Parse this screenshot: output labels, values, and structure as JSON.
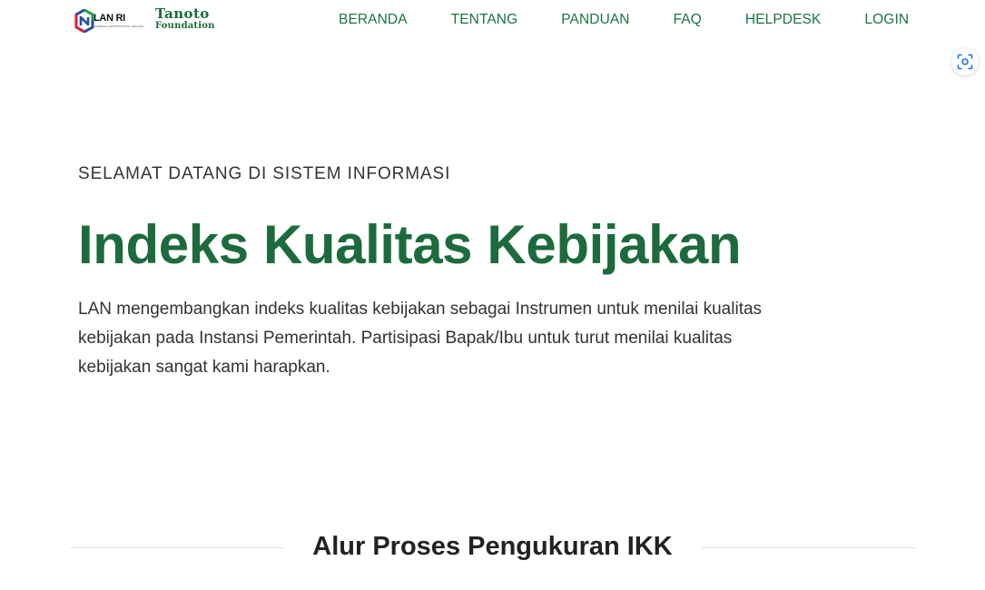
{
  "header": {
    "logo_lan": {
      "text": "LAN RI",
      "subtext": "LEMBAGA ADMINISTRASI NEGARA",
      "colors": {
        "red": "#d7262f",
        "blue": "#1d4f9e",
        "green": "#2e9b49"
      }
    },
    "logo_tanoto": {
      "line1": "Tanoto",
      "line2": "Foundation",
      "color": "#1b6b3a"
    },
    "nav": [
      {
        "label": "BERANDA"
      },
      {
        "label": "TENTANG"
      },
      {
        "label": "PANDUAN"
      },
      {
        "label": "FAQ"
      },
      {
        "label": "HELPDESK"
      },
      {
        "label": "LOGIN"
      }
    ],
    "nav_color": "#1b7340"
  },
  "floating": {
    "icon": "scan-icon"
  },
  "hero": {
    "kicker": "SELAMAT DATANG DI SISTEM INFORMASI",
    "title": "Indeks Kualitas Kebijakan",
    "description": "LAN mengembangkan indeks kualitas kebijakan sebagai Instrumen untuk menilai kualitas kebijakan pada Instansi Pemerintah. Partisipasi Bapak/Ibu untuk turut menilai kualitas kebijakan sangat kami harapkan.",
    "title_color": "#1d6b3c"
  },
  "section": {
    "title": "Alur Proses Pengukuran IKK"
  }
}
